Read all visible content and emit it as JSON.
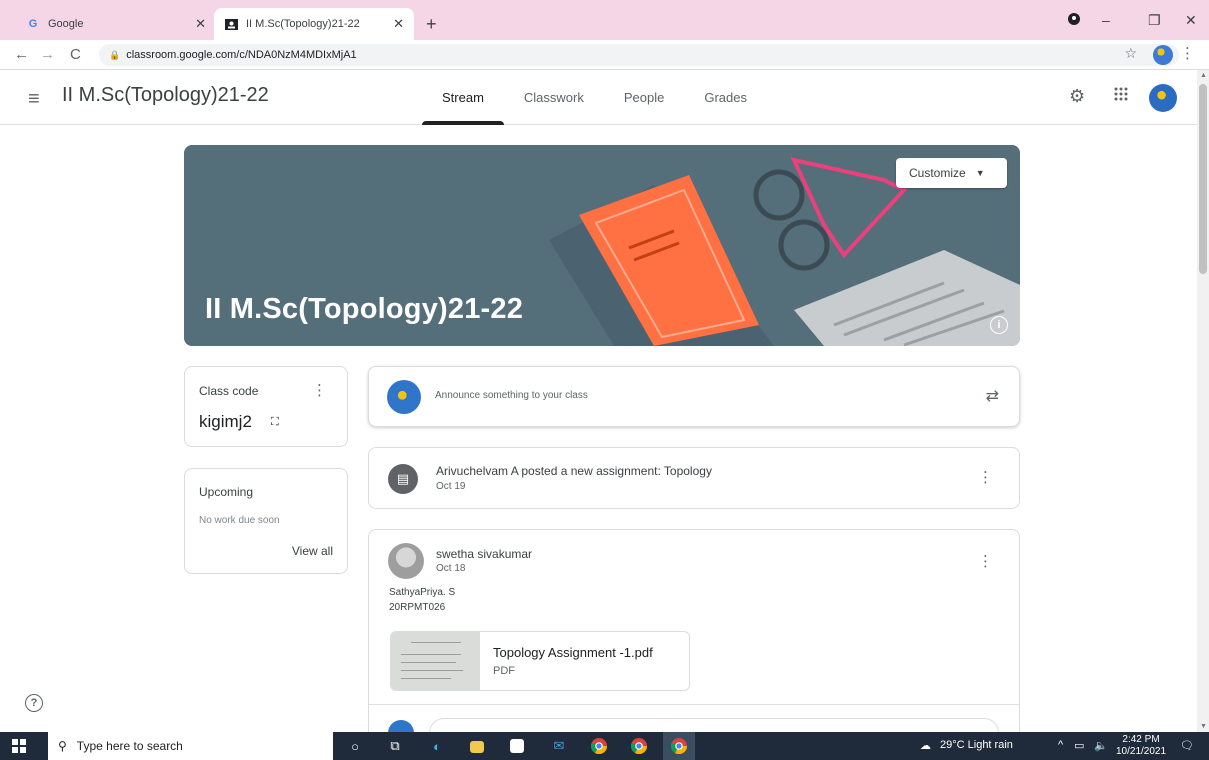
{
  "browser": {
    "tabs": [
      {
        "title": "Google",
        "favicon": "G",
        "active": false
      },
      {
        "title": "II M.Sc(Topology)21-22",
        "favicon": "classroom-favicon",
        "active": true
      }
    ],
    "new_tab": "+",
    "url": "classroom.google.com/c/NDA0NzM4MDIxMjA1"
  },
  "header": {
    "class_title": "II M.Sc(Topology)21-22",
    "tabs": [
      {
        "label": "Stream",
        "active": true
      },
      {
        "label": "Classwork",
        "active": false
      },
      {
        "label": "People",
        "active": false
      },
      {
        "label": "Grades",
        "active": false
      }
    ]
  },
  "banner": {
    "title": "II M.Sc(Topology)21-22",
    "customize_label": "Customize",
    "background_color": "#546e7a"
  },
  "class_code": {
    "label": "Class code",
    "code": "kigimj2"
  },
  "upcoming": {
    "title": "Upcoming",
    "empty_text": "No work due soon",
    "view_all": "View all"
  },
  "stream": {
    "announce_placeholder": "Announce something to your class",
    "assignment": {
      "title": "Arivuchelvam A posted a new assignment: Topology",
      "date": "Oct 19"
    },
    "post": {
      "author": "swetha sivakumar",
      "date": "Oct 18",
      "body_lines": [
        "SathyaPriya. S",
        "20RPMT026"
      ],
      "attachment": {
        "name": "Topology Assignment -1.pdf",
        "type": "PDF"
      }
    }
  },
  "taskbar": {
    "search_placeholder": "Type here to search",
    "weather": "29°C  Light rain",
    "time": "2:42 PM",
    "date": "10/21/2021"
  }
}
